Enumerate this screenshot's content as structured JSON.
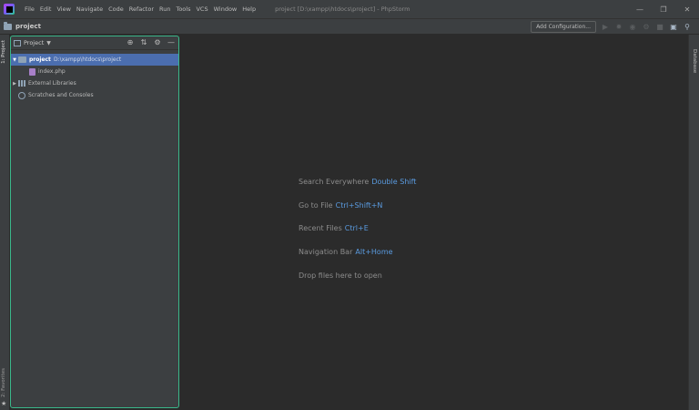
{
  "menu": {
    "items": [
      "File",
      "Edit",
      "View",
      "Navigate",
      "Code",
      "Refactor",
      "Run",
      "Tools",
      "VCS",
      "Window",
      "Help"
    ],
    "window_title": "project [D:\\xampp\\htdocs\\project] - PhpStorm"
  },
  "navbar": {
    "breadcrumb": "project",
    "add_configuration": "Add Configuration..."
  },
  "left_strip": {
    "project_label": "1: Project",
    "favorites_label": "2: Favorites"
  },
  "right_strip": {
    "database_label": "Database"
  },
  "project_panel": {
    "title": "Project",
    "tree": [
      {
        "name": "project",
        "path": "D:\\xampp\\htdocs\\project"
      },
      {
        "name": "index.php"
      },
      {
        "name": "External Libraries"
      },
      {
        "name": "Scratches and Consoles"
      }
    ]
  },
  "editor": {
    "hints": [
      {
        "label": "Search Everywhere",
        "key": "Double Shift"
      },
      {
        "label": "Go to File",
        "key": "Ctrl+Shift+N"
      },
      {
        "label": "Recent Files",
        "key": "Ctrl+E"
      },
      {
        "label": "Navigation Bar",
        "key": "Alt+Home"
      },
      {
        "label": "Drop files here to open",
        "key": ""
      }
    ]
  },
  "colors": {
    "selection": "#4b6eaf",
    "panel_border": "#3ab78a",
    "shortcut_key": "#5a9be0"
  }
}
